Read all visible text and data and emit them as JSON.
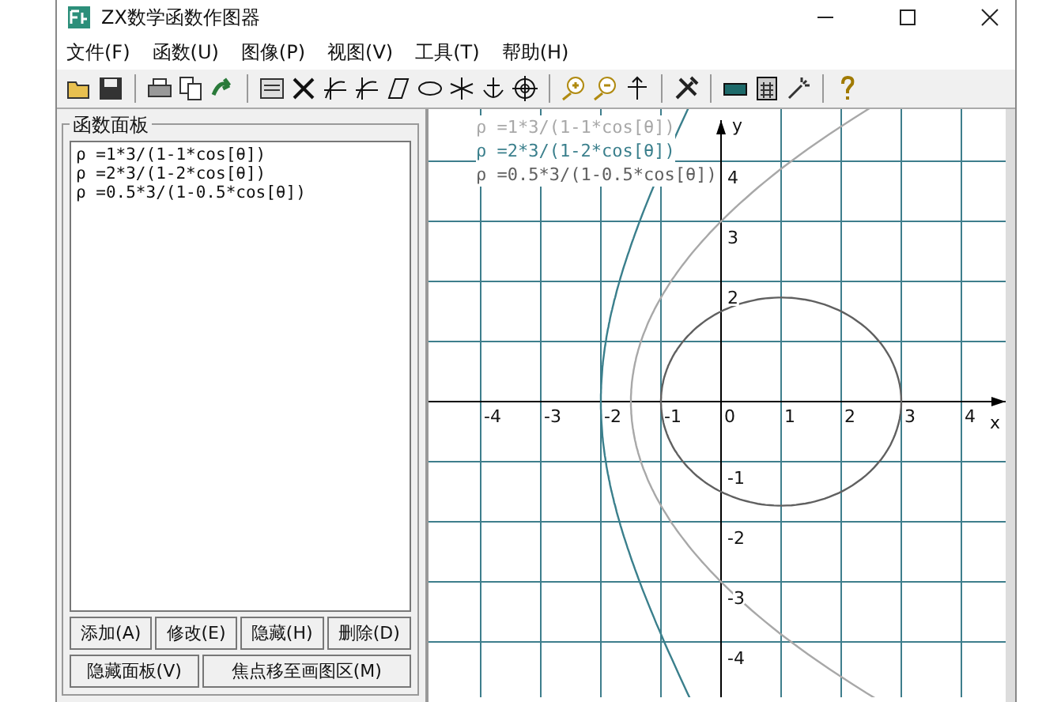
{
  "window": {
    "title": "ZX数学函数作图器"
  },
  "menu": [
    "文件(F)",
    "函数(U)",
    "图像(P)",
    "视图(V)",
    "工具(T)",
    "帮助(H)"
  ],
  "panel": {
    "title": "函数面板",
    "functions": [
      {
        "formula": "ρ =1*3/(1-1*cos[θ])"
      },
      {
        "formula": "ρ =2*3/(1-2*cos[θ])"
      },
      {
        "formula": "ρ =0.5*3/(1-0.5*cos[θ])"
      }
    ],
    "buttons": [
      [
        "添加(A)",
        "修改(E)",
        "隐藏(H)",
        "删除(D)"
      ],
      [
        "隐藏面板(V)",
        "焦点移至画图区(M)"
      ]
    ]
  },
  "graph": {
    "x_label": "x",
    "y_label": "y",
    "legend": [
      {
        "formula": "ρ =1*3/(1-1*cos[θ])",
        "color": "#a8a8a8"
      },
      {
        "formula": "ρ =2*3/(1-2*cos[θ])",
        "color": "#3a7f8c"
      },
      {
        "formula": "ρ =0.5*3/(1-0.5*cos[θ])",
        "color": "#606060"
      }
    ],
    "x_ticks": [
      "-4",
      "-3",
      "-2",
      "-1",
      "0",
      "1",
      "2",
      "3",
      "4"
    ],
    "y_ticks": [
      "4",
      "3",
      "2",
      "-1",
      "-2",
      "-3",
      "-4"
    ]
  }
}
